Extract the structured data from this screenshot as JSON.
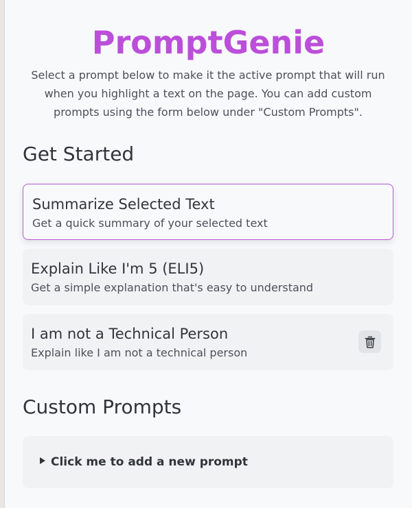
{
  "app": {
    "title": "PromptGenie",
    "subtitle": "Select a prompt below to make it the active prompt that will run when you highlight a text on the page. You can add custom prompts using the form below under \"Custom Prompts\".",
    "accent_color": "#bb4fd9"
  },
  "sections": {
    "get_started": "Get Started",
    "custom_prompts": "Custom Prompts"
  },
  "prompts": [
    {
      "title": "Summarize Selected Text",
      "description": "Get a quick summary of your selected text",
      "active": true,
      "deletable": false
    },
    {
      "title": "Explain Like I'm 5 (ELI5)",
      "description": "Get a simple explanation that's easy to understand",
      "active": false,
      "deletable": false
    },
    {
      "title": "I am not a Technical Person",
      "description": "Explain like I am not a technical person",
      "active": false,
      "deletable": true,
      "delete_icon": "trash-icon"
    }
  ],
  "custom_form": {
    "toggle_label": "Click me to add a new prompt",
    "toggle_icon": "disclosure-triangle-icon"
  }
}
